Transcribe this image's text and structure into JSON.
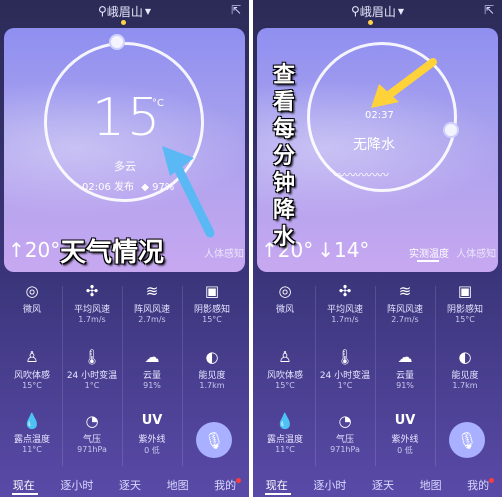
{
  "location": "峨眉山",
  "left": {
    "temperature": "15",
    "degree_symbol": "°C",
    "condition": "多云",
    "published": "02:06 发布",
    "humidity": "97%",
    "high": "↑20°",
    "low": "↓",
    "tab_feel": "人体感知",
    "annotation": "天气情况"
  },
  "right": {
    "time": "02:37",
    "precip": "无降水",
    "high": "↑20°",
    "low": "↓14°",
    "tab_measured": "实测温度",
    "tab_feel": "人体感知",
    "annotation": [
      "查",
      "看",
      "每",
      "分",
      "钟",
      "降",
      "水"
    ]
  },
  "grid": [
    {
      "icon": "compass-icon",
      "glyph": "◎",
      "label": "微风",
      "value": ""
    },
    {
      "icon": "fan-icon",
      "glyph": "✣",
      "label": "平均风速",
      "value": "1.7m/s"
    },
    {
      "icon": "wind-icon",
      "glyph": "≋",
      "label": "阵风风速",
      "value": "2.7m/s"
    },
    {
      "icon": "shadow-icon",
      "glyph": "▣",
      "label": "阴影感知",
      "value": "15°C"
    },
    {
      "icon": "person-wind-icon",
      "glyph": "♙",
      "label": "风吹体感",
      "value": "15°C"
    },
    {
      "icon": "thermometer-icon",
      "glyph": "🌡",
      "label": "24 小时变温",
      "value": "1°C"
    },
    {
      "icon": "cloud-icon",
      "glyph": "☁",
      "label": "云量",
      "value": "91%"
    },
    {
      "icon": "visibility-icon",
      "glyph": "◐",
      "label": "能见度",
      "value": "1.7km"
    },
    {
      "icon": "dewdrop-icon",
      "glyph": "💧",
      "label": "露点温度",
      "value": "11°C"
    },
    {
      "icon": "gauge-icon",
      "glyph": "◔",
      "label": "气压",
      "value": "971hPa"
    },
    {
      "icon": "uv-icon",
      "glyph": "UV",
      "label": "紫外线",
      "value": "0 低"
    }
  ],
  "nav": {
    "now": "现在",
    "hourly": "逐小时",
    "daily": "逐天",
    "map": "地图",
    "mine": "我的"
  },
  "colors": {
    "accent": "#ffd24a",
    "arrow_blue": "#5ab8f5",
    "arrow_yellow": "#ffd23a",
    "badge": "#ff3b3b"
  }
}
